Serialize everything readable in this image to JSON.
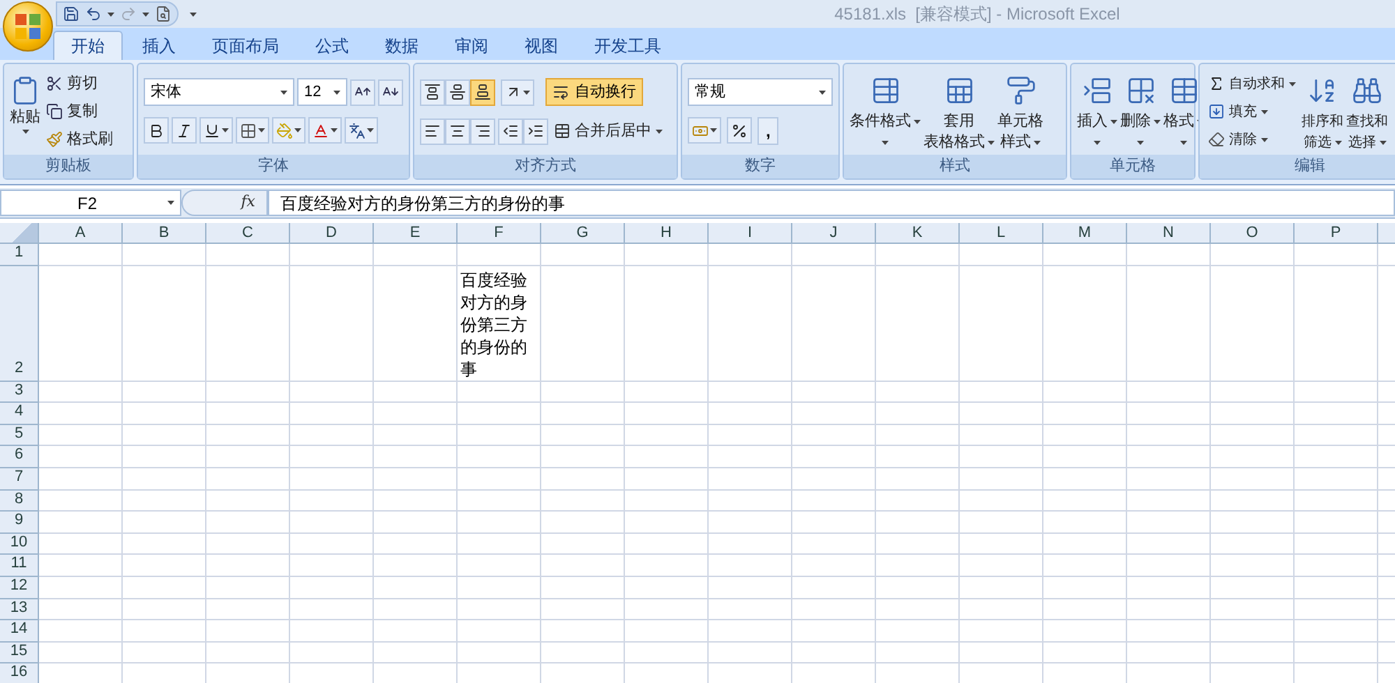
{
  "window": {
    "title": "45181.xls  [兼容模式] - Microsoft Excel"
  },
  "tabs": [
    {
      "label": "开始",
      "selected": true
    },
    {
      "label": "插入",
      "selected": false
    },
    {
      "label": "页面布局",
      "selected": false
    },
    {
      "label": "公式",
      "selected": false
    },
    {
      "label": "数据",
      "selected": false
    },
    {
      "label": "审阅",
      "selected": false
    },
    {
      "label": "视图",
      "selected": false
    },
    {
      "label": "开发工具",
      "selected": false
    }
  ],
  "ribbon": {
    "clipboard": {
      "title": "剪贴板",
      "paste": "粘贴",
      "cut": "剪切",
      "copy": "复制",
      "format_painter": "格式刷"
    },
    "font": {
      "title": "字体",
      "font_name": "宋体",
      "font_size": "12"
    },
    "alignment": {
      "title": "对齐方式",
      "vertical_alignment": [
        {
          "selected": false
        },
        {
          "selected": false
        },
        {
          "selected": true
        }
      ],
      "wrap_text": {
        "label": "自动换行",
        "on": true
      },
      "merge": "合并后居中"
    },
    "number": {
      "title": "数字",
      "format": "常规",
      "comma": ","
    },
    "styles": {
      "title": "样式",
      "buttons": [
        {
          "lines": [
            "条件格式"
          ]
        },
        {
          "lines": [
            "套用",
            "表格格式"
          ]
        },
        {
          "lines": [
            "单元格",
            "样式"
          ]
        }
      ]
    },
    "cells": {
      "title": "单元格",
      "buttons": [
        "插入",
        "删除",
        "格式"
      ]
    },
    "editing": {
      "title": "编辑",
      "autosum": "自动求和",
      "fill": "填充",
      "clear": "清除",
      "sort": [
        "排序和",
        "筛选"
      ],
      "find": [
        "查找和",
        "选择"
      ]
    }
  },
  "formula_bar": {
    "name_box": "F2",
    "fx": "fx",
    "formula": "百度经验对方的身份第三方的身份的事"
  },
  "sheet": {
    "columns": [
      "A",
      "B",
      "C",
      "D",
      "E",
      "F",
      "G",
      "H",
      "I",
      "J",
      "K",
      "L",
      "M",
      "N",
      "O",
      "P"
    ],
    "rows": [
      {
        "number": "1",
        "tall": false
      },
      {
        "number": "2",
        "tall": true,
        "cells": [
          null,
          null,
          null,
          null,
          null,
          "百度经验对方的身份第三方的身份的事"
        ]
      },
      {
        "number": "3",
        "tall": false
      },
      {
        "number": "4",
        "tall": false
      },
      {
        "number": "5",
        "tall": false
      },
      {
        "number": "6",
        "tall": false
      },
      {
        "number": "7",
        "tall": false
      },
      {
        "number": "8",
        "tall": false
      },
      {
        "number": "9",
        "tall": false
      },
      {
        "number": "10",
        "tall": false
      },
      {
        "number": "11",
        "tall": false
      },
      {
        "number": "12",
        "tall": false
      },
      {
        "number": "13",
        "tall": false
      },
      {
        "number": "14",
        "tall": false
      },
      {
        "number": "15",
        "tall": false
      },
      {
        "number": "16",
        "tall": false
      }
    ]
  }
}
